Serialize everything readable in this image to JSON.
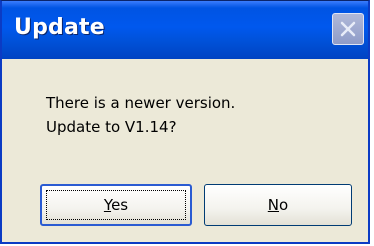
{
  "window": {
    "title": "Update",
    "close_icon": "close-icon"
  },
  "message": {
    "line1": "There is a newer version.",
    "line2": "Update to V1.14?"
  },
  "buttons": {
    "yes": {
      "mnemonic": "Y",
      "rest": "es"
    },
    "no": {
      "mnemonic": "N",
      "rest": "o"
    }
  },
  "colors": {
    "titlebar": "#0058ee",
    "dialog_background": "#ece9d8",
    "close_button": "#9aa6d0"
  }
}
